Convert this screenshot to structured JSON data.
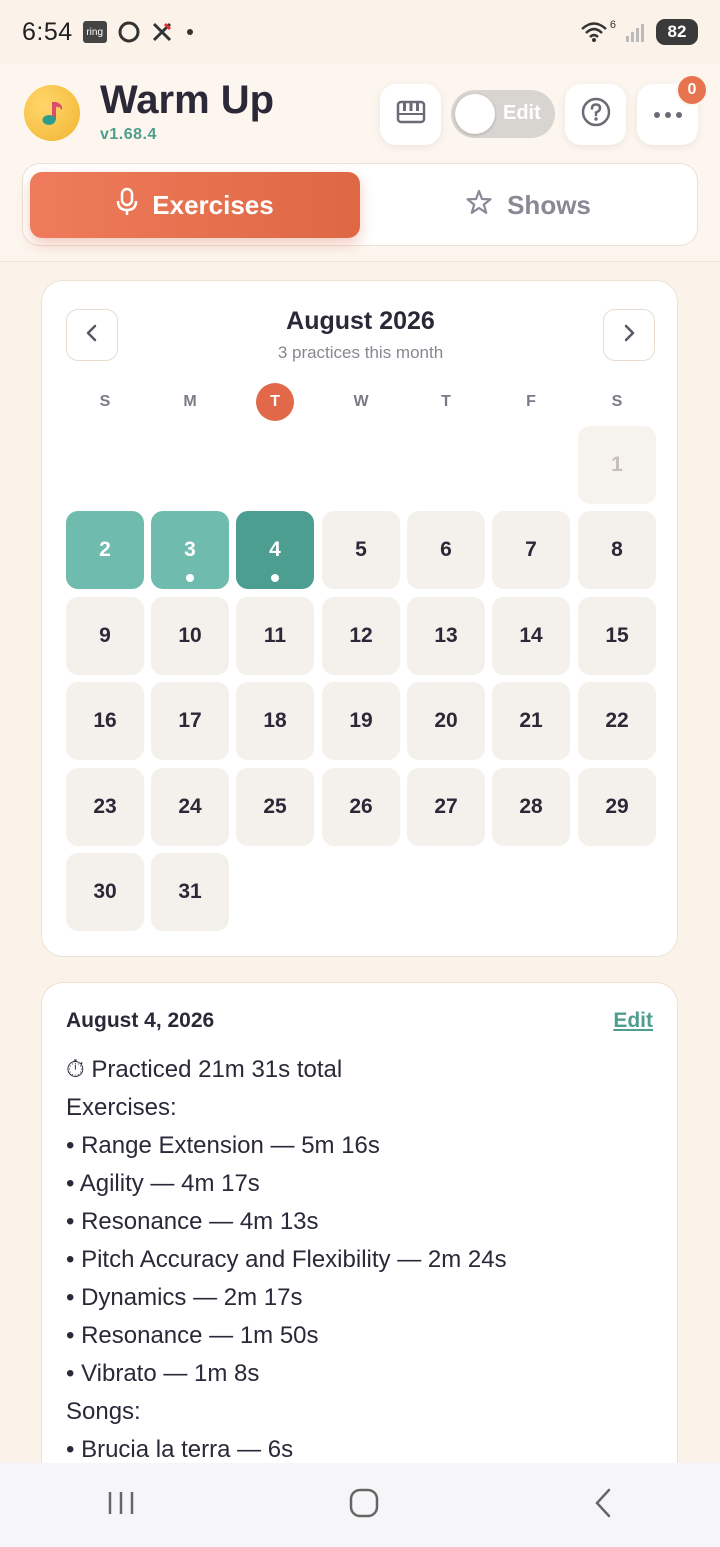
{
  "status_bar": {
    "time": "6:54",
    "ring_label": "ring",
    "network_label": "6",
    "battery": "82"
  },
  "header": {
    "title": "Warm Up",
    "version": "v1.68.4",
    "edit_label": "Edit",
    "menu_badge": "0",
    "icons": [
      "music-note-icon",
      "piano-icon",
      "help-icon",
      "more-icon"
    ]
  },
  "tabs": [
    {
      "label": "Exercises",
      "icon": "microphone-icon",
      "active": true
    },
    {
      "label": "Shows",
      "icon": "star-icon",
      "active": false
    }
  ],
  "calendar": {
    "month_title": "August 2026",
    "subtitle": "3 practices this month",
    "weekdays": [
      "S",
      "M",
      "T",
      "W",
      "T",
      "F",
      "S"
    ],
    "today_weekday_index": 2,
    "leading_blanks": 6,
    "days": [
      "1",
      "2",
      "3",
      "4",
      "5",
      "6",
      "7",
      "8",
      "9",
      "10",
      "11",
      "12",
      "13",
      "14",
      "15",
      "16",
      "17",
      "18",
      "19",
      "20",
      "21",
      "22",
      "23",
      "24",
      "25",
      "26",
      "27",
      "28",
      "29",
      "30",
      "31"
    ],
    "practiced_days": [
      2,
      3,
      4
    ],
    "days_with_dot": [
      3,
      4
    ],
    "selected_day": 4
  },
  "detail": {
    "date": "August 4, 2026",
    "edit_label": "Edit",
    "lines": [
      "⏱ Practiced 21m 31s total",
      "Exercises:",
      "• Range Extension — 5m 16s",
      "• Agility — 4m 17s",
      "• Resonance — 4m 13s",
      "• Pitch Accuracy and Flexibility — 2m 24s",
      "• Dynamics — 2m 17s",
      "• Resonance — 1m 50s",
      "• Vibrato — 1m 8s",
      "Songs:",
      "• Brucia la terra — 6s"
    ]
  },
  "colors": {
    "accent": "#e2684a",
    "teal": "#4f9d8e",
    "practiced": "#6fbcaf",
    "background": "#fbf3ea"
  }
}
